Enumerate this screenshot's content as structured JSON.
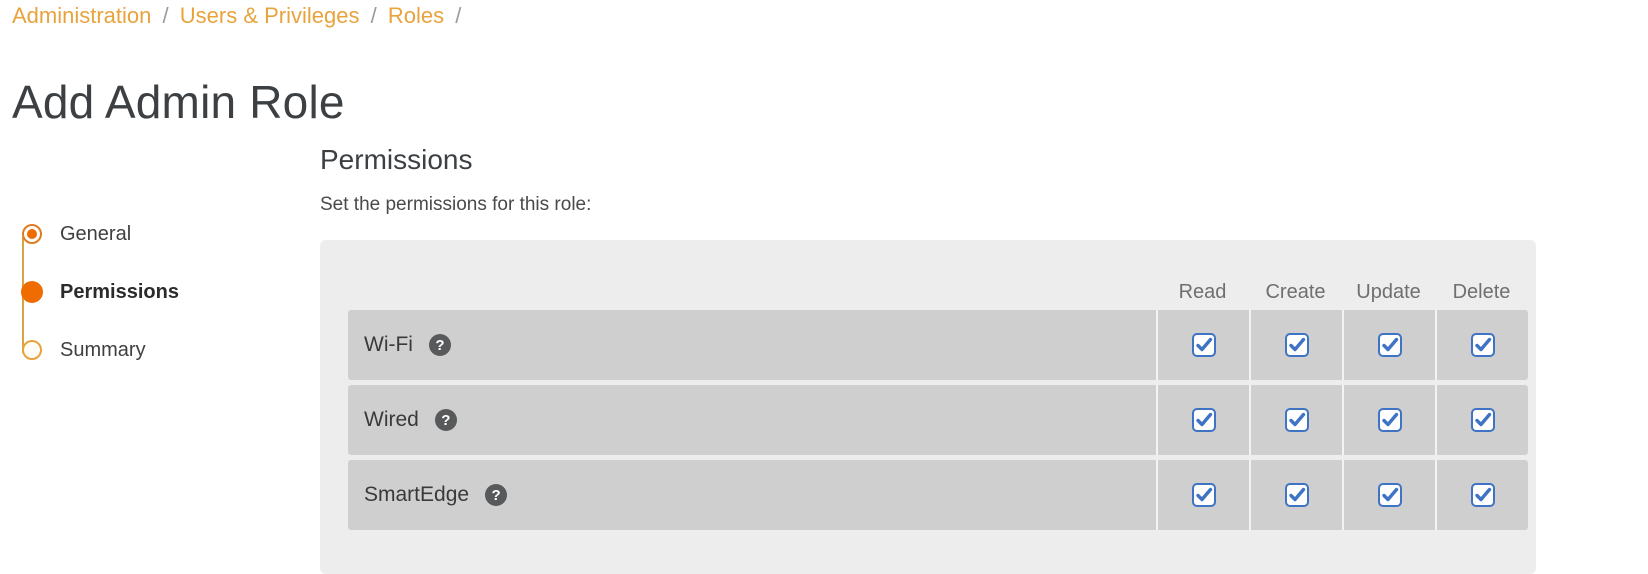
{
  "breadcrumb": {
    "items": [
      {
        "label": "Administration"
      },
      {
        "label": "Users & Privileges"
      },
      {
        "label": "Roles"
      }
    ],
    "separator": "/",
    "trailing_separator": "/"
  },
  "page": {
    "title": "Add Admin Role"
  },
  "stepper": {
    "steps": [
      {
        "label": "General",
        "state": "done"
      },
      {
        "label": "Permissions",
        "state": "current"
      },
      {
        "label": "Summary",
        "state": "todo"
      }
    ]
  },
  "permissions": {
    "heading": "Permissions",
    "subtitle": "Set the permissions for this role:",
    "columns": [
      "Read",
      "Create",
      "Update",
      "Delete"
    ],
    "help_glyph": "?",
    "rows": [
      {
        "label": "Wi-Fi",
        "help": "?",
        "read": true,
        "create": true,
        "update": true,
        "delete": true
      },
      {
        "label": "Wired",
        "help": "?",
        "read": true,
        "create": true,
        "update": true,
        "delete": true
      },
      {
        "label": "SmartEdge",
        "help": "?",
        "read": true,
        "create": true,
        "update": true,
        "delete": true
      }
    ]
  },
  "colors": {
    "accent_orange": "#ef6c00",
    "breadcrumb_link": "#e8a33d",
    "checkbox_blue": "#3f73c4",
    "panel_bg": "#ededed",
    "row_bg": "#cfcfcf"
  }
}
